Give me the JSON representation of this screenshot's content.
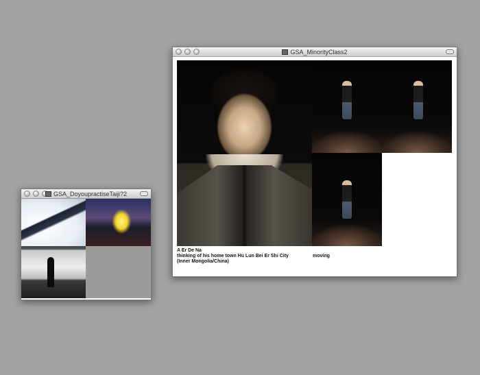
{
  "windows": {
    "small": {
      "title": "GSA_DoyoupractiseTaiji?2"
    },
    "large": {
      "title": "GSA_MinorityClass2",
      "captions": {
        "line1": "A Er De Na",
        "line2": "thinking of his home town Hu Lun Bei Er Shi City",
        "line3": "(Inner Mongolia/China)",
        "moving": "moving"
      }
    }
  },
  "icons": {
    "close": "traffic-light-icon",
    "minimize": "traffic-light-icon",
    "zoom": "traffic-light-icon",
    "toolbar": "toolbar-toggle-icon",
    "document": "document-icon"
  }
}
